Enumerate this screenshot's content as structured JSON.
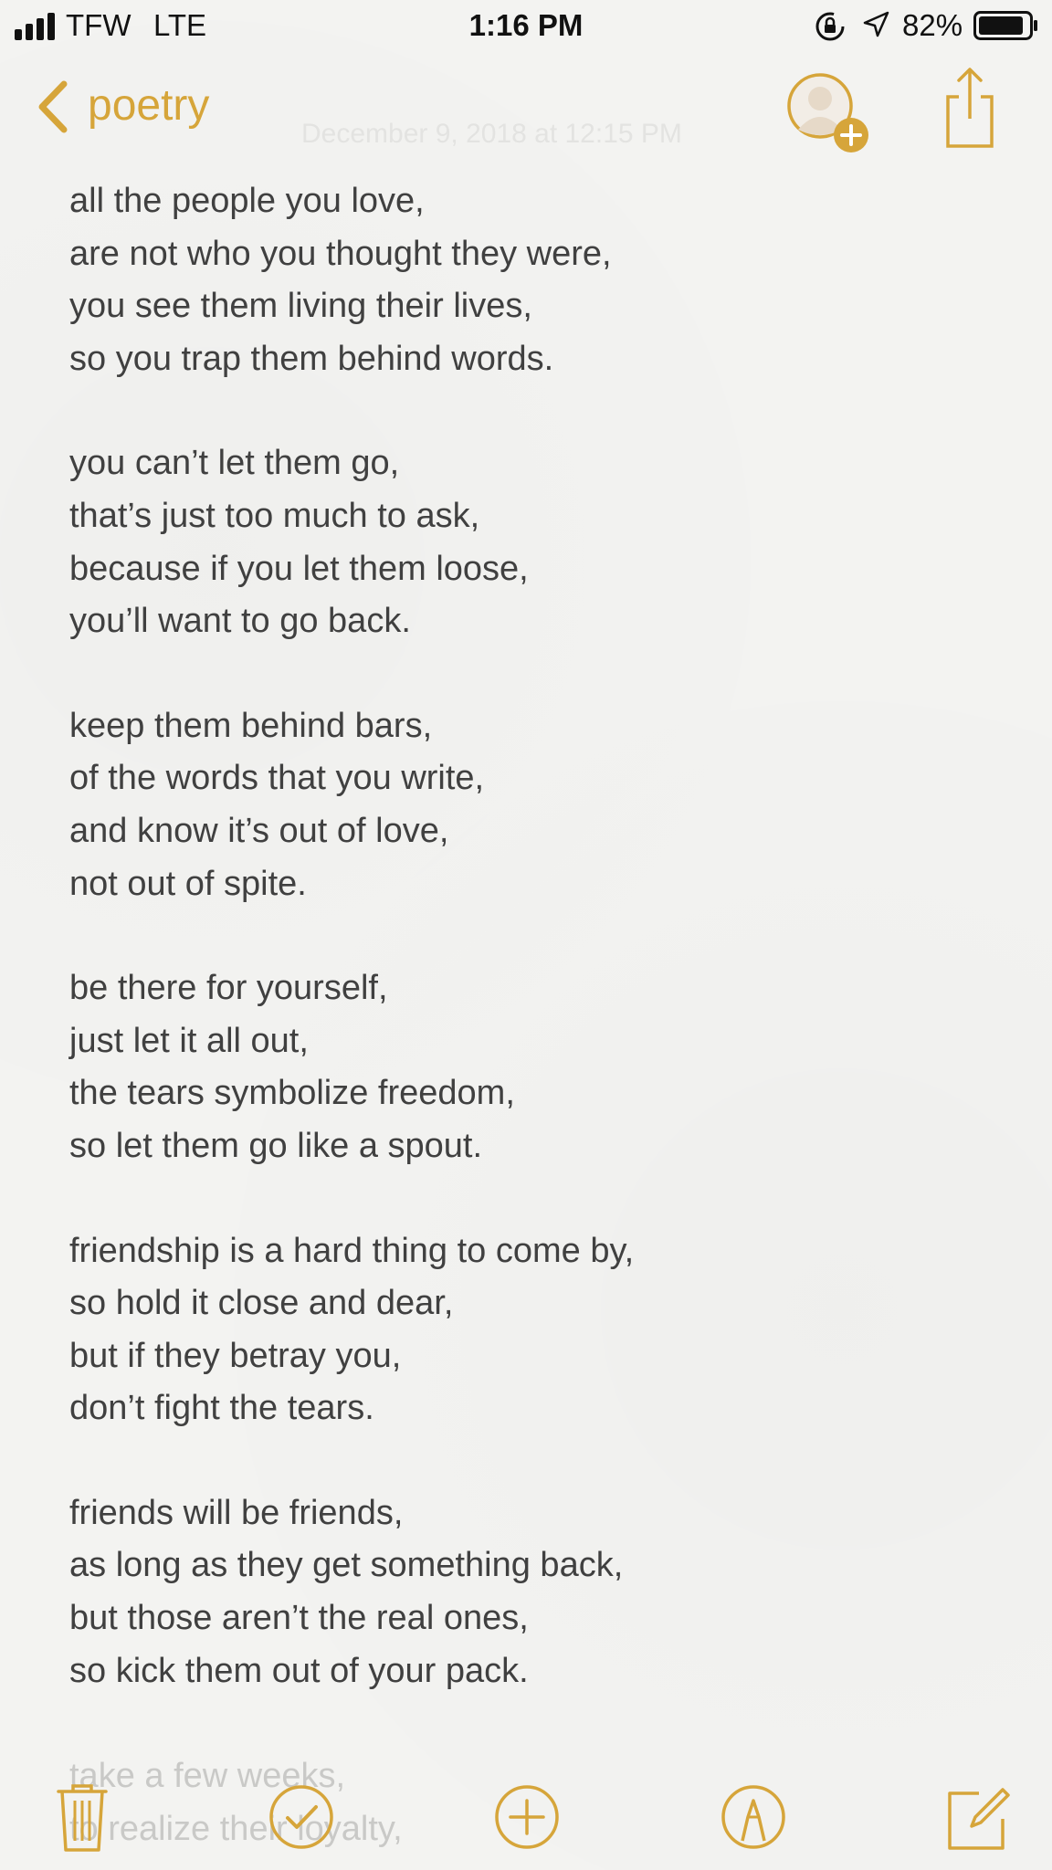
{
  "status_bar": {
    "carrier": "TFW",
    "network": "LTE",
    "time": "1:16 PM",
    "battery_percent": "82%",
    "icons": [
      "signal-bars-icon",
      "rotation-lock-icon",
      "location-arrow-icon",
      "battery-icon"
    ]
  },
  "nav": {
    "back_label": "poetry",
    "faded_date": "December 9, 2018 at 12:15 PM",
    "icons": [
      "chevron-left-icon",
      "add-person-icon",
      "share-icon"
    ]
  },
  "note": {
    "stanzas": [
      [
        "all the people you love,",
        "are not who you thought they were,",
        "you see them living their lives,",
        "so you trap them behind words."
      ],
      [
        "you can’t let them go,",
        "that’s just too much to ask,",
        "because if you let them loose,",
        "you’ll want to go back."
      ],
      [
        "keep them behind bars,",
        "of the words that you write,",
        "and know it’s out of love,",
        "not out of spite."
      ],
      [
        "be there for yourself,",
        "just let it all out,",
        "the tears symbolize freedom,",
        "so let them go like a spout."
      ],
      [
        "friendship is a hard thing to come by,",
        "so hold it close and dear,",
        "but if they betray you,",
        "don’t fight the tears."
      ],
      [
        "friends will be friends,",
        "as long as they get something back,",
        "but those aren’t the real ones,",
        "so kick them out of your pack."
      ]
    ],
    "faded_lines": [
      "take a few weeks,",
      "to realize their loyalty,"
    ]
  },
  "toolbar": {
    "icons": [
      "trash-icon",
      "checklist-icon",
      "add-icon",
      "markup-icon",
      "compose-icon"
    ]
  },
  "colors": {
    "accent": "#d6a53a",
    "text": "#404040",
    "background": "#f3f3f1"
  }
}
